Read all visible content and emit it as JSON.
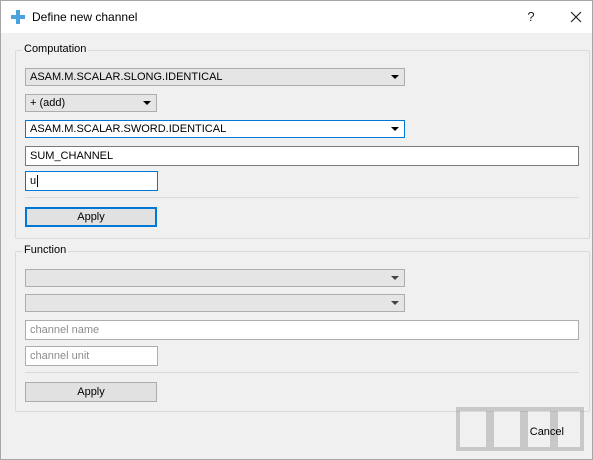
{
  "window": {
    "title": "Define new channel",
    "help_glyph": "?",
    "close_glyph": "×"
  },
  "computation": {
    "label": "Computation",
    "operand1": "ASAM.M.SCALAR.SLONG.IDENTICAL",
    "operator": "+ (add)",
    "operand2": "ASAM.M.SCALAR.SWORD.IDENTICAL",
    "channel_name": "SUM_CHANNEL",
    "channel_unit": "u",
    "apply_label": "Apply"
  },
  "function": {
    "label": "Function",
    "function_select": "",
    "channel_select": "",
    "channel_name_placeholder": "channel name",
    "channel_unit_placeholder": "channel unit",
    "apply_label": "Apply"
  },
  "footer": {
    "cancel_label": "Cancel"
  },
  "colors": {
    "accent": "#0078d7",
    "dialog_bg": "#f0f0f0"
  }
}
